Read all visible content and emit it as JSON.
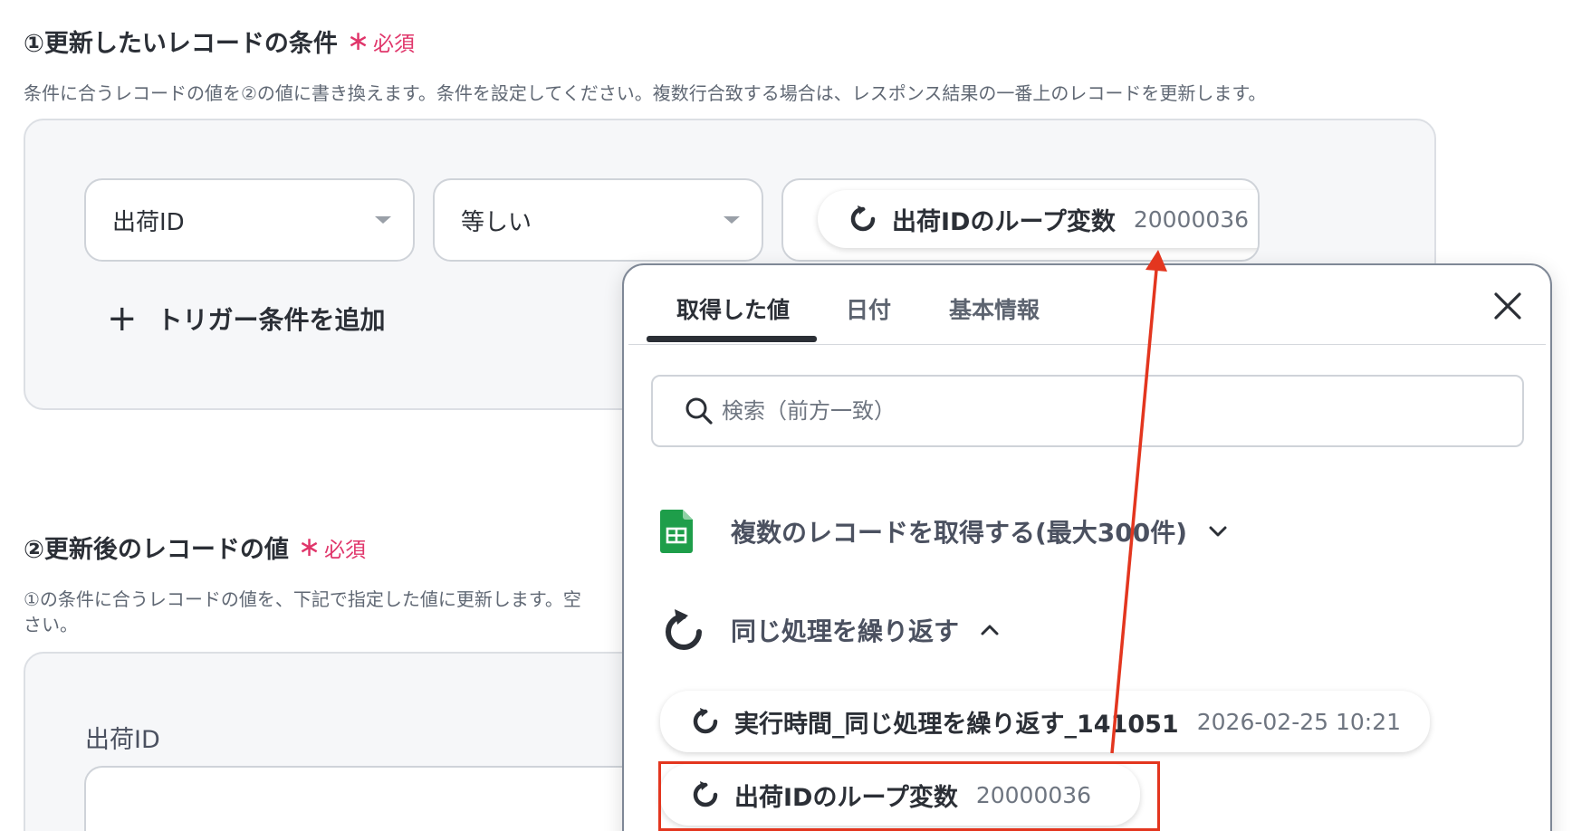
{
  "section1": {
    "title": "①更新したいレコードの条件",
    "required_star": "∗",
    "required_label": "必須",
    "description": "条件に合うレコードの値を②の値に書き換えます。条件を設定してください。複数行合致する場合は、レスポンス結果の一番上のレコードを更新します。",
    "condition": {
      "field_value": "出荷ID",
      "operator_value": "等しい",
      "chip_label": "出荷IDのループ変数",
      "chip_value": "20000036"
    },
    "add_condition_label": "トリガー条件を追加"
  },
  "section2": {
    "title": "②更新後のレコードの値",
    "required_star": "∗",
    "required_label": "必須",
    "description_line1": "①の条件に合うレコードの値を、下記で指定した値に更新します。空",
    "description_line2": "さい。",
    "field_label": "出荷ID"
  },
  "dropdown": {
    "tabs": [
      {
        "label": "取得した値",
        "active": true
      },
      {
        "label": "日付",
        "active": false
      },
      {
        "label": "基本情報",
        "active": false
      }
    ],
    "search_placeholder": "検索（前方一致）",
    "groups": [
      {
        "label": "複数のレコードを取得する(最大300件)",
        "icon": "google-sheets-icon",
        "expanded": false
      },
      {
        "label": "同じ処理を繰り返す",
        "icon": "loop-icon",
        "expanded": true
      }
    ],
    "items": [
      {
        "label": "実行時間_同じ処理を繰り返す_141051",
        "value": "2026-02-25 10:21",
        "icon": "loop-icon"
      },
      {
        "label": "出荷IDのループ変数",
        "value": "20000036",
        "icon": "loop-icon",
        "highlighted": true
      }
    ]
  },
  "colors": {
    "required": "#e0356a",
    "annotation": "#e3361f",
    "sheets_green": "#1e9e4a",
    "text": "#2b2f36"
  }
}
